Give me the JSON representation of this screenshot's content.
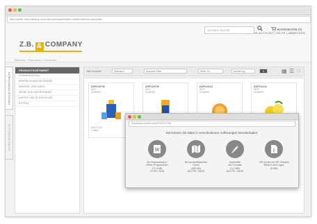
{
  "browser": {
    "url": "http://zeller-mein-destny-mein.de/download/hotels-medienrettem-download"
  },
  "header": {
    "logo_left": "Z.B.",
    "logo_amp": "&",
    "logo_right": "COMPANY",
    "nav": "BENUTZERWECHSEL  |  MEIN ACCOUNT  |  HILFE  |  ABMELDEN",
    "search_placeholder": "SCHNELLSUCHE",
    "cart_label": "WARENKORB (0)"
  },
  "breadcrumb": "Startseite / Warenkorb / Download",
  "side_tabs": [
    "PRODUKTSORTIMENT",
    "WARENKOBKISTE"
  ],
  "sidebar": {
    "title": "PRODUKTSORTIMENT",
    "items": [
      "SOMMERAKTION",
      "ERFRISCHUNGSGETRÄNKE",
      "WASSER- UND LIMOS",
      "WEINE UND MIXGETRÄNKE",
      "KAFFEE UND SCHOKOLADE",
      "EXTRAS"
    ]
  },
  "toolbar": {
    "sort_label": "Alle Auswahl",
    "sort_value": "Standard",
    "filter_value": "Auswahl Filter",
    "page_value": "Seite 1/1",
    "order_value": "Sortierung",
    "go": "▾"
  },
  "products": [
    {
      "code": "DOP120709",
      "line1": "MILD",
      "line2": "SOMMER"
    },
    {
      "code": "DOP120709",
      "line1": "MILD",
      "line2": "SOMMER"
    },
    {
      "code": "DOP121111",
      "line1": "BEST",
      "line2": "SOMMER"
    },
    {
      "code": "DOP121111",
      "line1": "BEST",
      "line2": "SOMMER"
    }
  ],
  "card_date": "08.07.2013",
  "card_date2": "1 Bilder",
  "modal": {
    "url": "download.website.com/DOP110709",
    "title": "Sie können die Datei in verschiedenen Auflösungen herunterladen:",
    "options": [
      {
        "icon": "word-document-icon",
        "line1": "für Verwendung in",
        "line2": "Office-Programmen",
        "line3": "(71,5 kB)",
        "line4": "72 PPI, RGB"
      },
      {
        "icon": "map-icon",
        "line1": "für hochauflösenden",
        "line2": "Druck",
        "line3": "(960 kB)",
        "line4": "300 PPI, CMYK"
      },
      {
        "icon": "pencil-icon",
        "line1": "Zuschnitte",
        "line2": "auf Formate",
        "line3": "(1,2 MB)",
        "line4": "300 PPI, CMYK"
      },
      {
        "icon": "zip-archive-icon",
        "line1": "ZIP-Archiv mit ZIP-Gesamt",
        "line2": "Bildern und Logos",
        "line3": "(3 MB)",
        "line4": ""
      }
    ]
  },
  "colors": {
    "accent": "#e8b200",
    "sidebar_head": "#666666",
    "icon_circle": "#888888"
  }
}
